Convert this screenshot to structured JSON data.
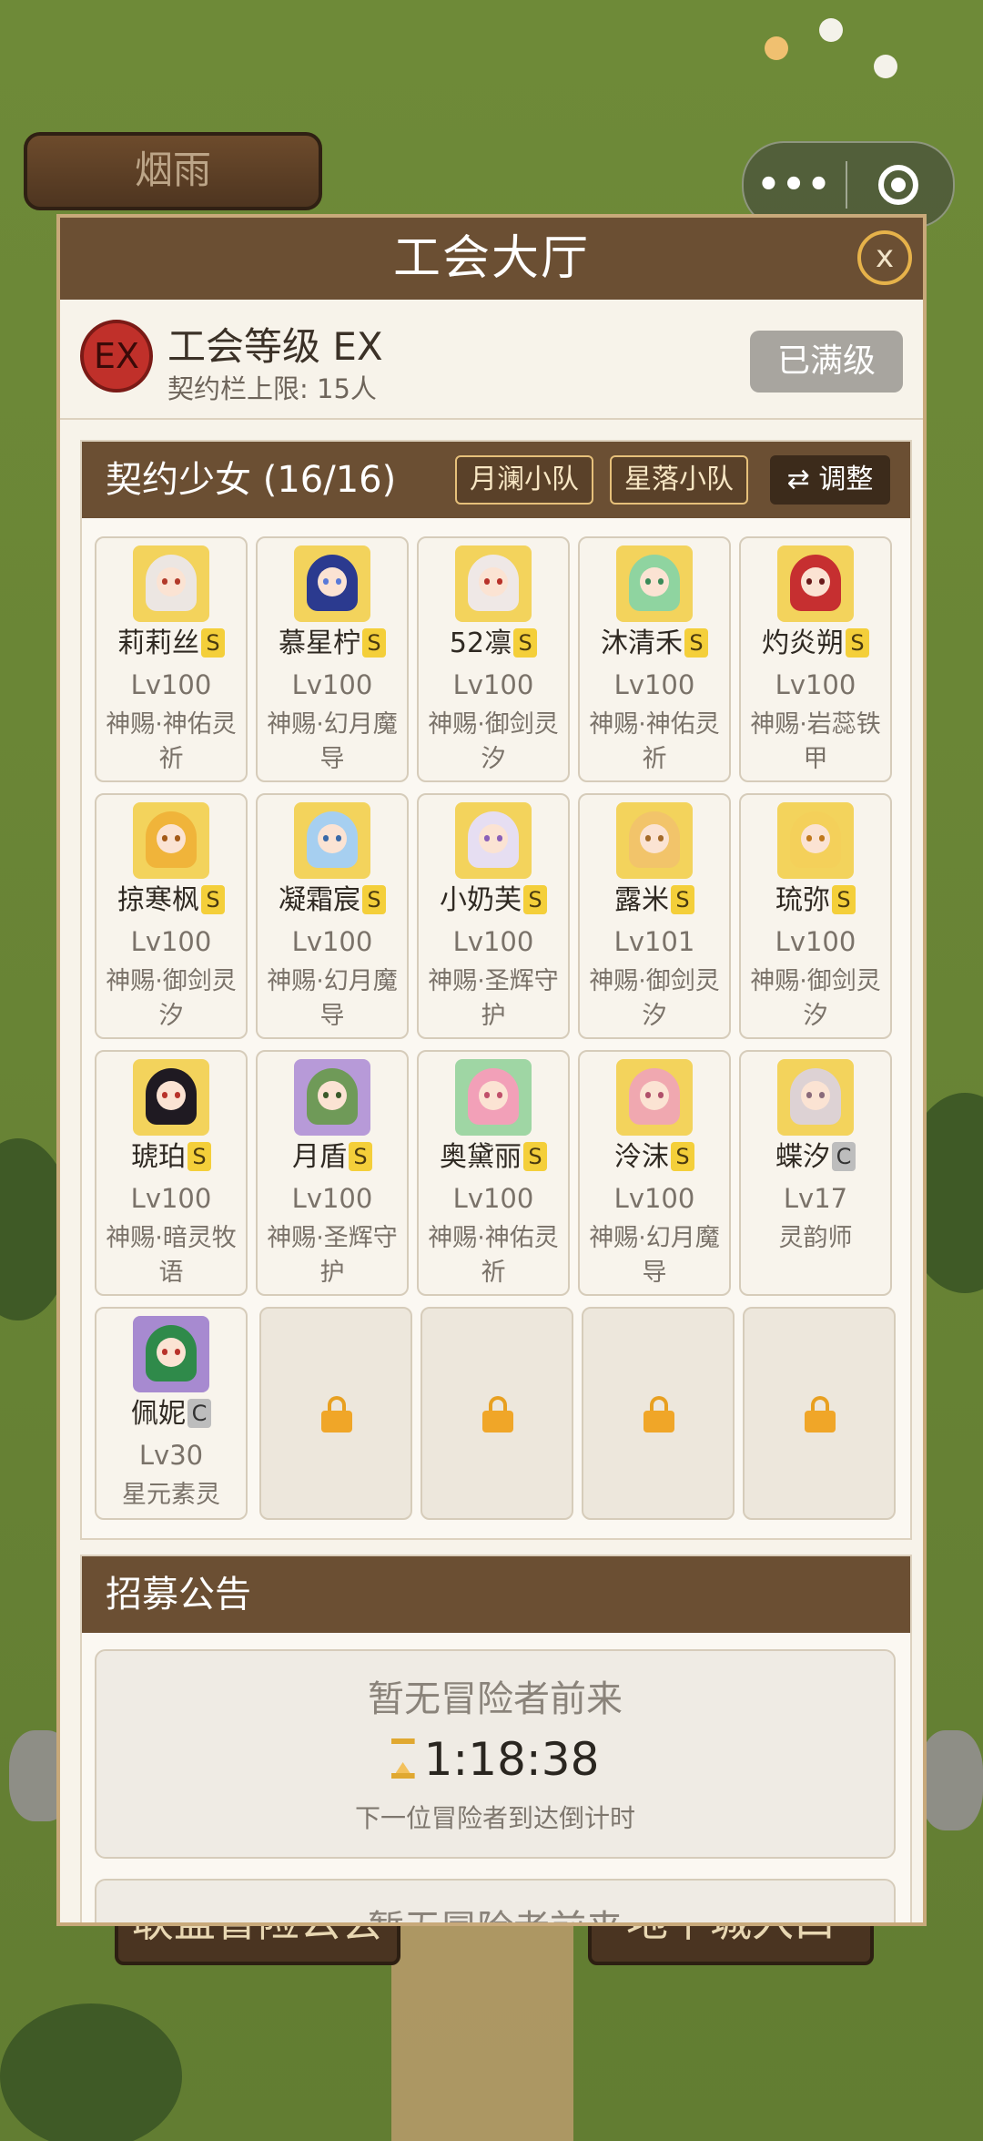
{
  "town_sign": "烟雨",
  "background_buttons": [
    "联盟冒险公会",
    "地下城入口"
  ],
  "miniprogram": {
    "more_icon": "more-dots-icon",
    "close_icon": "target-icon"
  },
  "modal": {
    "title": "工会大厅",
    "close_label": "x",
    "guild": {
      "badge": "EX",
      "level_label": "工会等级 EX",
      "capacity_label": "契约栏上限: 15人",
      "max_button": "已满级"
    },
    "roster": {
      "title": "契约少女 (16/16)",
      "team1": "月澜小队",
      "team2": "星落小队",
      "adjust": "⇄ 调整",
      "members": [
        {
          "name": "莉莉丝",
          "rank": "S",
          "lv": "Lv100",
          "cls": "神赐·神佑灵祈",
          "hair": "#ece6e2",
          "eye": "#b23a2a",
          "bg": "#f3d35c"
        },
        {
          "name": "慕星柠",
          "rank": "S",
          "lv": "Lv100",
          "cls": "神赐·幻月魔导",
          "hair": "#2b3a8f",
          "eye": "#5a7ad8",
          "bg": "#f3d35c"
        },
        {
          "name": "52凛",
          "rank": "S",
          "lv": "Lv100",
          "cls": "神赐·御剑灵汐",
          "hair": "#efe8e6",
          "eye": "#b8322a",
          "bg": "#f3d35c"
        },
        {
          "name": "沐清禾",
          "rank": "S",
          "lv": "Lv100",
          "cls": "神赐·神佑灵祈",
          "hair": "#8fd4a0",
          "eye": "#3a8a58",
          "bg": "#f3d35c"
        },
        {
          "name": "灼炎朔",
          "rank": "S",
          "lv": "Lv100",
          "cls": "神赐·岩蕊铁甲",
          "hair": "#c62f30",
          "eye": "#6a1a1a",
          "bg": "#f3d35c"
        },
        {
          "name": "掠寒枫",
          "rank": "S",
          "lv": "Lv100",
          "cls": "神赐·御剑灵汐",
          "hair": "#f0b43a",
          "eye": "#a45a18",
          "bg": "#f3d35c"
        },
        {
          "name": "凝霜宸",
          "rank": "S",
          "lv": "Lv100",
          "cls": "神赐·幻月魔导",
          "hair": "#a6cff0",
          "eye": "#3a6aa8",
          "bg": "#f3d35c"
        },
        {
          "name": "小奶芙",
          "rank": "S",
          "lv": "Lv100",
          "cls": "神赐·圣辉守护",
          "hair": "#e6def2",
          "eye": "#8a5fb8",
          "bg": "#f3d35c"
        },
        {
          "name": "露米",
          "rank": "S",
          "lv": "Lv101",
          "cls": "神赐·御剑灵汐",
          "hair": "#f2c46a",
          "eye": "#a46a2a",
          "bg": "#f3d35c"
        },
        {
          "name": "琉弥",
          "rank": "S",
          "lv": "Lv100",
          "cls": "神赐·御剑灵汐",
          "hair": "#f4d05a",
          "eye": "#c0781e",
          "bg": "#f3d35c"
        },
        {
          "name": "琥珀",
          "rank": "S",
          "lv": "Lv100",
          "cls": "神赐·暗灵牧语",
          "hair": "#1f1a22",
          "eye": "#b8322a",
          "bg": "#f3d35c"
        },
        {
          "name": "月盾",
          "rank": "S",
          "lv": "Lv100",
          "cls": "神赐·圣辉守护",
          "hair": "#6f9a58",
          "eye": "#3a5a2a",
          "bg": "#b79ad8"
        },
        {
          "name": "奥黛丽",
          "rank": "S",
          "lv": "Lv100",
          "cls": "神赐·神佑灵祈",
          "hair": "#f2a0b8",
          "eye": "#c0506a",
          "bg": "#9fd6a4"
        },
        {
          "name": "泠沫",
          "rank": "S",
          "lv": "Lv100",
          "cls": "神赐·幻月魔导",
          "hair": "#f0a8b0",
          "eye": "#b0506a",
          "bg": "#f3d35c"
        },
        {
          "name": "蝶汐",
          "rank": "C",
          "lv": "Lv17",
          "cls": "灵韵师",
          "hair": "#ddd2d4",
          "eye": "#8a6a7a",
          "bg": "#f3d35c"
        },
        {
          "name": "佩妮",
          "rank": "C",
          "lv": "Lv30",
          "cls": "星元素灵",
          "hair": "#2f8a4a",
          "eye": "#b8322a",
          "bg": "#a78ad0"
        }
      ],
      "locked_slots": 4
    },
    "recruit": {
      "title": "招募公告",
      "cards": [
        {
          "message": "暂无冒险者前来",
          "timer": "1:18:38",
          "sub": "下一位冒险者到达倒计时"
        },
        {
          "message": "暂无冒险者前来",
          "timer": "",
          "sub": ""
        }
      ]
    }
  }
}
